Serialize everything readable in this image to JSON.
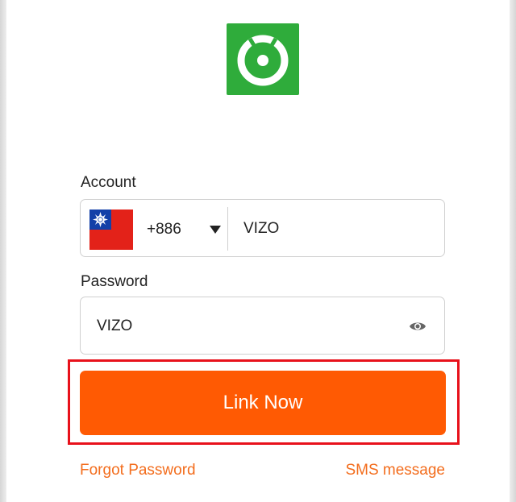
{
  "logo": {
    "icon": "app-logo-icon",
    "color": "#2fac3b"
  },
  "account": {
    "label": "Account",
    "country_code": "+886",
    "flag_icon": "taiwan-flag-icon",
    "value": "VIZO"
  },
  "password": {
    "label": "Password",
    "value": "VIZO",
    "toggle_icon": "eye-icon"
  },
  "primary_button": {
    "label": "Link Now",
    "color": "#ff5a03"
  },
  "links": {
    "forgot": "Forgot Password",
    "sms": "SMS message"
  },
  "colors": {
    "link": "#f36d1d",
    "highlight": "#e8111b"
  }
}
